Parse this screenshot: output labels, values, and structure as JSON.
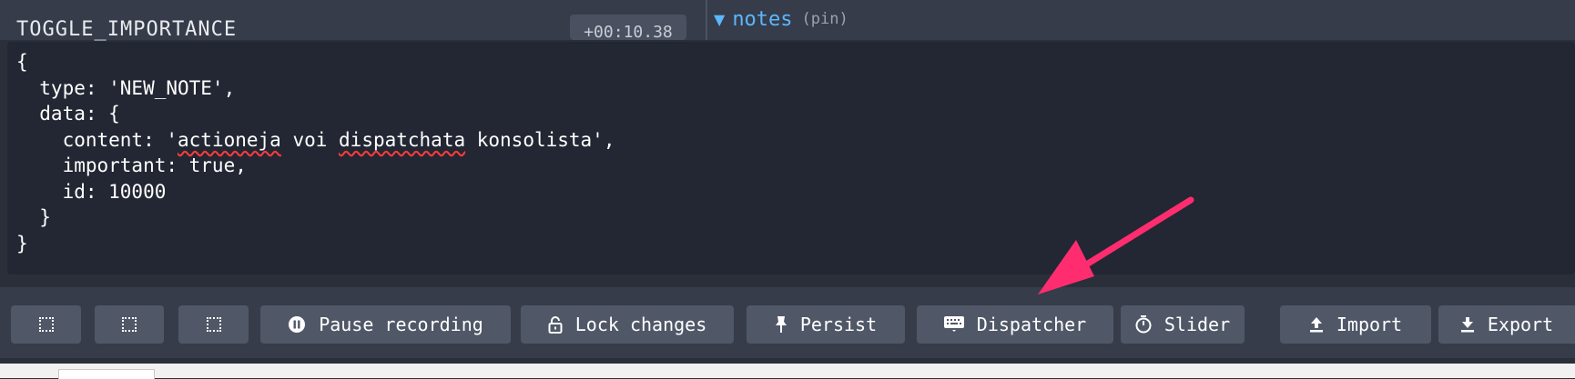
{
  "history": {
    "action_label": "TOGGLE_IMPORTANCE",
    "time_badge": "+00:10.38"
  },
  "state_tree": {
    "toggle": "▼",
    "key": "notes",
    "tag": "(pin)"
  },
  "editor": {
    "lines": [
      {
        "pre": "{",
        "squiggle": "",
        "post": ""
      },
      {
        "pre": "  type: 'NEW_NOTE',",
        "squiggle": "",
        "post": ""
      },
      {
        "pre": "  data: {",
        "squiggle": "",
        "post": ""
      },
      {
        "pre": "    content: '",
        "squiggle": "actioneja",
        "post": " voi dispatchata konsolista',"
      },
      {
        "pre": "    important: true,",
        "squiggle": "",
        "post": ""
      },
      {
        "pre": "    id: 10000",
        "squiggle": "",
        "post": ""
      },
      {
        "pre": "  }",
        "squiggle": "",
        "post": ""
      },
      {
        "pre": "}",
        "squiggle": "",
        "post": ""
      }
    ],
    "misspelled_extra": "dispatchata"
  },
  "toolbar": {
    "pause_label": "Pause recording",
    "lock_label": "Lock changes",
    "persist_label": "Persist",
    "dispatcher_label": "Dispatcher",
    "slider_label": "Slider",
    "import_label": "Import",
    "export_label": "Export"
  },
  "colors": {
    "arrow": "#ff2d6f",
    "accent": "#5bb7ff",
    "toolbar_button": "#505868",
    "editor_bg": "#222733"
  }
}
